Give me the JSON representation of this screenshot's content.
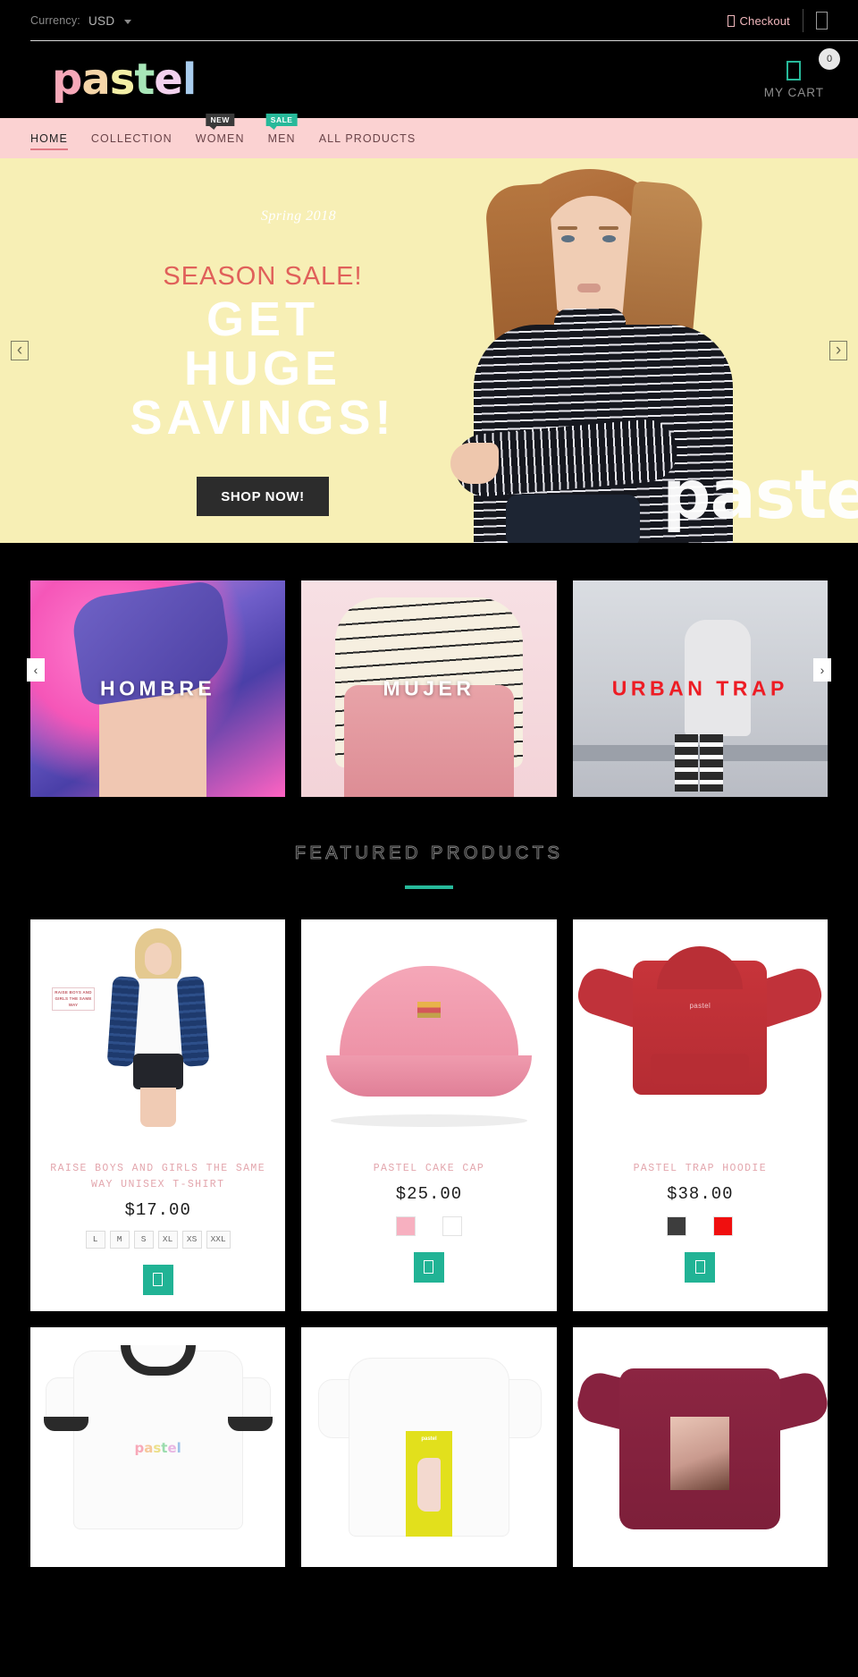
{
  "topbar": {
    "currency_label": "Currency:",
    "currency_value": "USD",
    "checkout_label": "Checkout",
    "checkout_icon": "lock-icon",
    "account_icon": "user-icon"
  },
  "header": {
    "logo_letters": [
      "p",
      "a",
      "s",
      "t",
      "e",
      "l"
    ],
    "logo_colors": [
      "#f7a8b8",
      "#f6d5a8",
      "#f4efa6",
      "#a8e6b8",
      "#f3d2ee",
      "#a9cdee"
    ],
    "cart_icon": "shopping-bag-icon",
    "cart_count": "0",
    "cart_label": "MY CART"
  },
  "nav": {
    "items": [
      {
        "label": "HOME",
        "active": true,
        "badge": null
      },
      {
        "label": "COLLECTION",
        "active": false,
        "badge": null
      },
      {
        "label": "WOMEN",
        "active": false,
        "badge": "NEW",
        "badge_color": "#3a3a3a"
      },
      {
        "label": "MEN",
        "active": false,
        "badge": "SALE",
        "badge_color": "#27b99a"
      },
      {
        "label": "ALL PRODUCTS",
        "active": false,
        "badge": null
      }
    ]
  },
  "hero": {
    "season": "Spring 2018",
    "sale_text": "SEASON SALE!",
    "line1": "GET",
    "line2": "HUGE",
    "line3": "SAVINGS!",
    "cta": "SHOP NOW!",
    "watermark": "pastel",
    "prev_icon": "chevron-left-icon",
    "next_icon": "chevron-right-icon",
    "prev_glyph": "‹",
    "next_glyph": "›",
    "bg_color": "#f7efb5",
    "accent_color": "#e0605a"
  },
  "categories": {
    "prev_glyph": "‹",
    "next_glyph": "›",
    "items": [
      {
        "label": "HOMBRE",
        "color": "#ffffff"
      },
      {
        "label": "MUJER",
        "color": "#ffffff"
      },
      {
        "label": "URBAN TRAP",
        "color": "#ed1c24"
      }
    ]
  },
  "featured": {
    "title": "FEATURED PRODUCTS",
    "rule_color": "#27b99a"
  },
  "products": [
    {
      "title": "RAISE BOYS AND GIRLS THE SAME WAY UNISEX T-SHIRT",
      "price": "$17.00",
      "sizes": [
        "L",
        "M",
        "S",
        "XL",
        "XS",
        "XXL"
      ],
      "swatches": [],
      "add_icon": "shopping-bag-icon",
      "print_text": "RAISE BOYS AND GIRLS THE SAME WAY"
    },
    {
      "title": "PASTEL CAKE CAP",
      "price": "$25.00",
      "sizes": [],
      "swatches": [
        "#f7b0c0",
        "#ffffff"
      ],
      "add_icon": "shopping-bag-icon"
    },
    {
      "title": "PASTEL TRAP HOODIE",
      "price": "$38.00",
      "sizes": [],
      "swatches": [
        "#3d3d3d",
        "#f00f0f"
      ],
      "add_icon": "shopping-bag-icon",
      "logo_text": "pastel"
    },
    {
      "title": "",
      "price": "",
      "sizes": [],
      "swatches": [],
      "logo_text": "pastel"
    },
    {
      "title": "",
      "price": "",
      "sizes": [],
      "swatches": [],
      "poster_text": "pastel"
    },
    {
      "title": "",
      "price": "",
      "sizes": [],
      "swatches": []
    }
  ]
}
